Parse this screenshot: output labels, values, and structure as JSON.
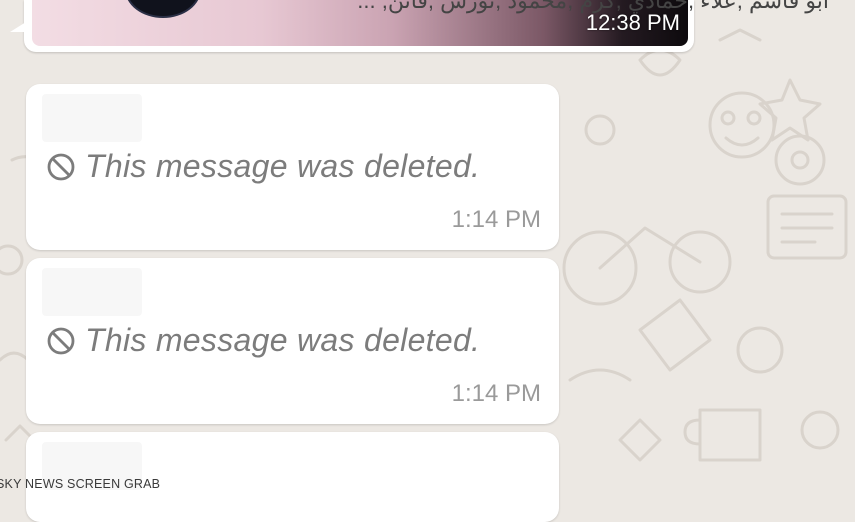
{
  "chat": {
    "participants": "... ,أبو قاسم ,علاء ,حمادي ,كرم ,محمود ,نورس ,فاتن",
    "media_time": "12:38 PM"
  },
  "messages": [
    {
      "text": "This message was deleted.",
      "time": "1:14 PM",
      "icon": "ban-icon"
    },
    {
      "text": "This message was deleted.",
      "time": "1:14 PM",
      "icon": "ban-icon"
    }
  ],
  "watermark": "SKY NEWS SCREEN GRAB"
}
